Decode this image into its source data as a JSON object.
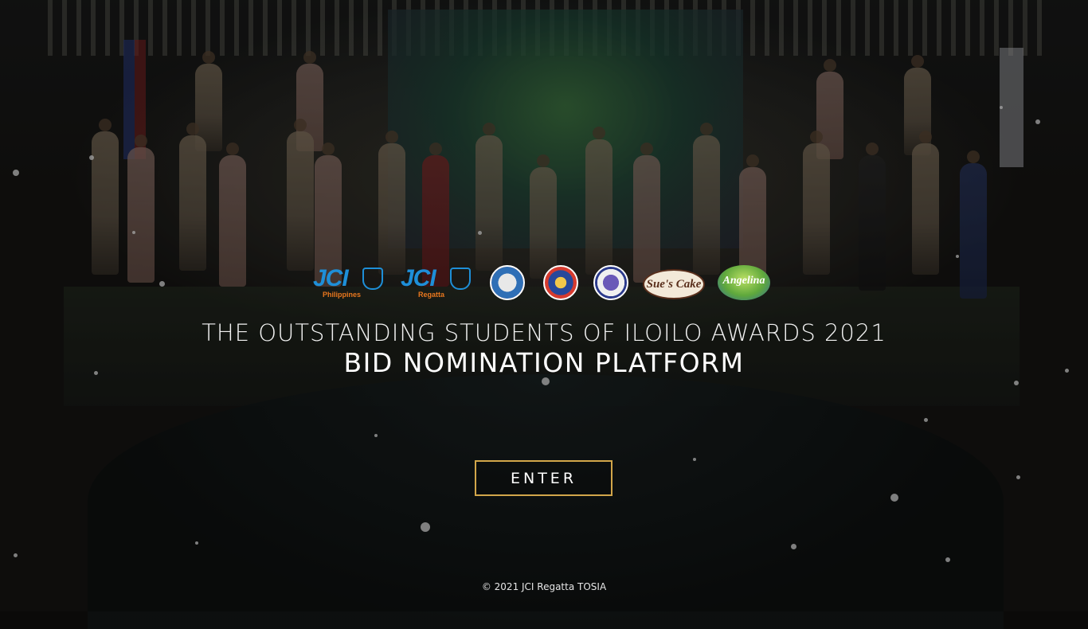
{
  "background": {
    "description_icon": "award-ceremony-photo"
  },
  "logos": [
    {
      "name": "jci-philippines-logo",
      "text": "JCI",
      "sub": "Philippines",
      "sub_color": "#e8771e"
    },
    {
      "name": "jci-regatta-logo",
      "text": "JCI",
      "sub": "Regatta",
      "sub_color": "#e8771e"
    },
    {
      "name": "tosia-seal-logo"
    },
    {
      "name": "dilg-seal-logo"
    },
    {
      "name": "deped-seal-logo"
    },
    {
      "name": "sues-cake-gallery-logo",
      "text": "Sue's Cake"
    },
    {
      "name": "angelina-logo",
      "text": "Angelina"
    }
  ],
  "hero": {
    "title": "THE OUTSTANDING STUDENTS OF ILOILO AWARDS 2021",
    "subtitle": "BID NOMINATION PLATFORM"
  },
  "enter_button": {
    "label": "ENTER",
    "border_color": "#d2a64a"
  },
  "footer": {
    "copyright": "© 2021 JCI Regatta TOSIA"
  }
}
